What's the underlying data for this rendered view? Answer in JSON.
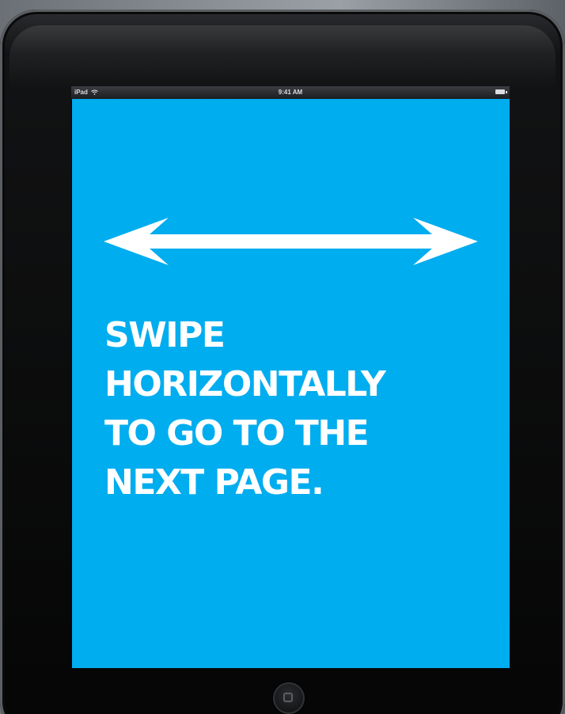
{
  "status_bar": {
    "device_label": "iPad",
    "time": "9:41 AM",
    "wifi_icon": "wifi-icon",
    "battery_icon": "battery-icon",
    "battery_level": 1.0
  },
  "screen": {
    "background_color": "#00adef",
    "text_color": "#ffffff",
    "arrow_icon": "double-headed-arrow-icon",
    "message": "SWIPE\nHORIZONTALLY\nTO GO TO THE\nNEXT PAGE."
  },
  "device": {
    "home_button_icon": "home-button-icon"
  }
}
